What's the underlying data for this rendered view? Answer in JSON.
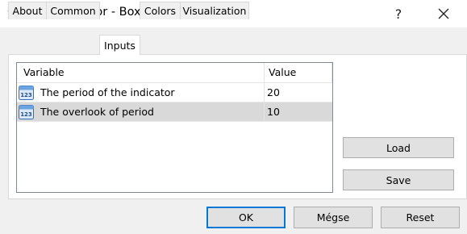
{
  "window": {
    "title": "Custom Indicator - Box",
    "help_label": "?"
  },
  "tabs": [
    {
      "label": "About"
    },
    {
      "label": "Common"
    },
    {
      "label": "Inputs",
      "active": true
    },
    {
      "label": "Colors"
    },
    {
      "label": "Visualization"
    }
  ],
  "grid": {
    "headers": {
      "variable": "Variable",
      "value": "Value"
    },
    "rows": [
      {
        "icon": "number-123-icon",
        "variable": "The period of the indicator",
        "value": "20"
      },
      {
        "icon": "number-123-icon",
        "variable": "The overlook of period",
        "value": "10",
        "selected": true
      }
    ]
  },
  "side_buttons": {
    "load": "Load",
    "save": "Save"
  },
  "footer": {
    "ok": "OK",
    "cancel": "Mégse",
    "reset": "Reset"
  },
  "colors": {
    "accent": "#0078d7",
    "selected_row": "#d9d9d9",
    "icon_blue": "#2f6fb7"
  }
}
